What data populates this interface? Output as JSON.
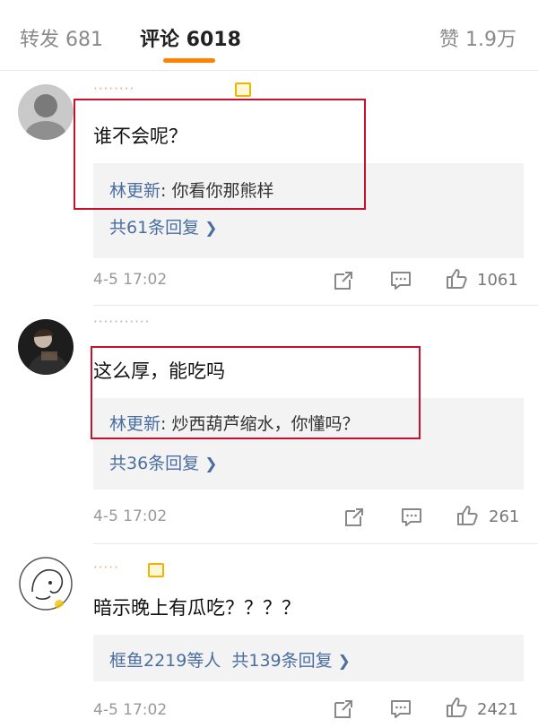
{
  "tabs": {
    "repost": "转发 681",
    "comments": "评论 6018",
    "likes": "赞 1.9万"
  },
  "comments": [
    {
      "avatar": "avatar-photo-1",
      "text": "谁不会呢？",
      "reply_author": "林更新",
      "reply_text": ": 你看你那熊样",
      "reply_more": "共61条回复",
      "time": "4-5 17:02",
      "likes": "1061"
    },
    {
      "avatar": "avatar-photo-2",
      "text": "这么厚，能吃吗",
      "reply_author": "林更新",
      "reply_text": ": 炒西葫芦缩水，你懂吗？",
      "reply_more": "共36条回复",
      "time": "4-5 17:02",
      "likes": "261"
    },
    {
      "avatar": "avatar-sketch-3",
      "text": "暗示晚上有瓜吃？？？？",
      "reply_users": "框鱼2219等人",
      "reply_more": "共139条回复",
      "time": "4-5 17:02",
      "likes": "2421"
    }
  ],
  "colors": {
    "accent": "#ff8200",
    "link": "#4a6ea0",
    "highlight_box": "#c8102e"
  },
  "icons": [
    "repost-icon",
    "comment-icon",
    "like-icon",
    "chevron-right-icon"
  ]
}
